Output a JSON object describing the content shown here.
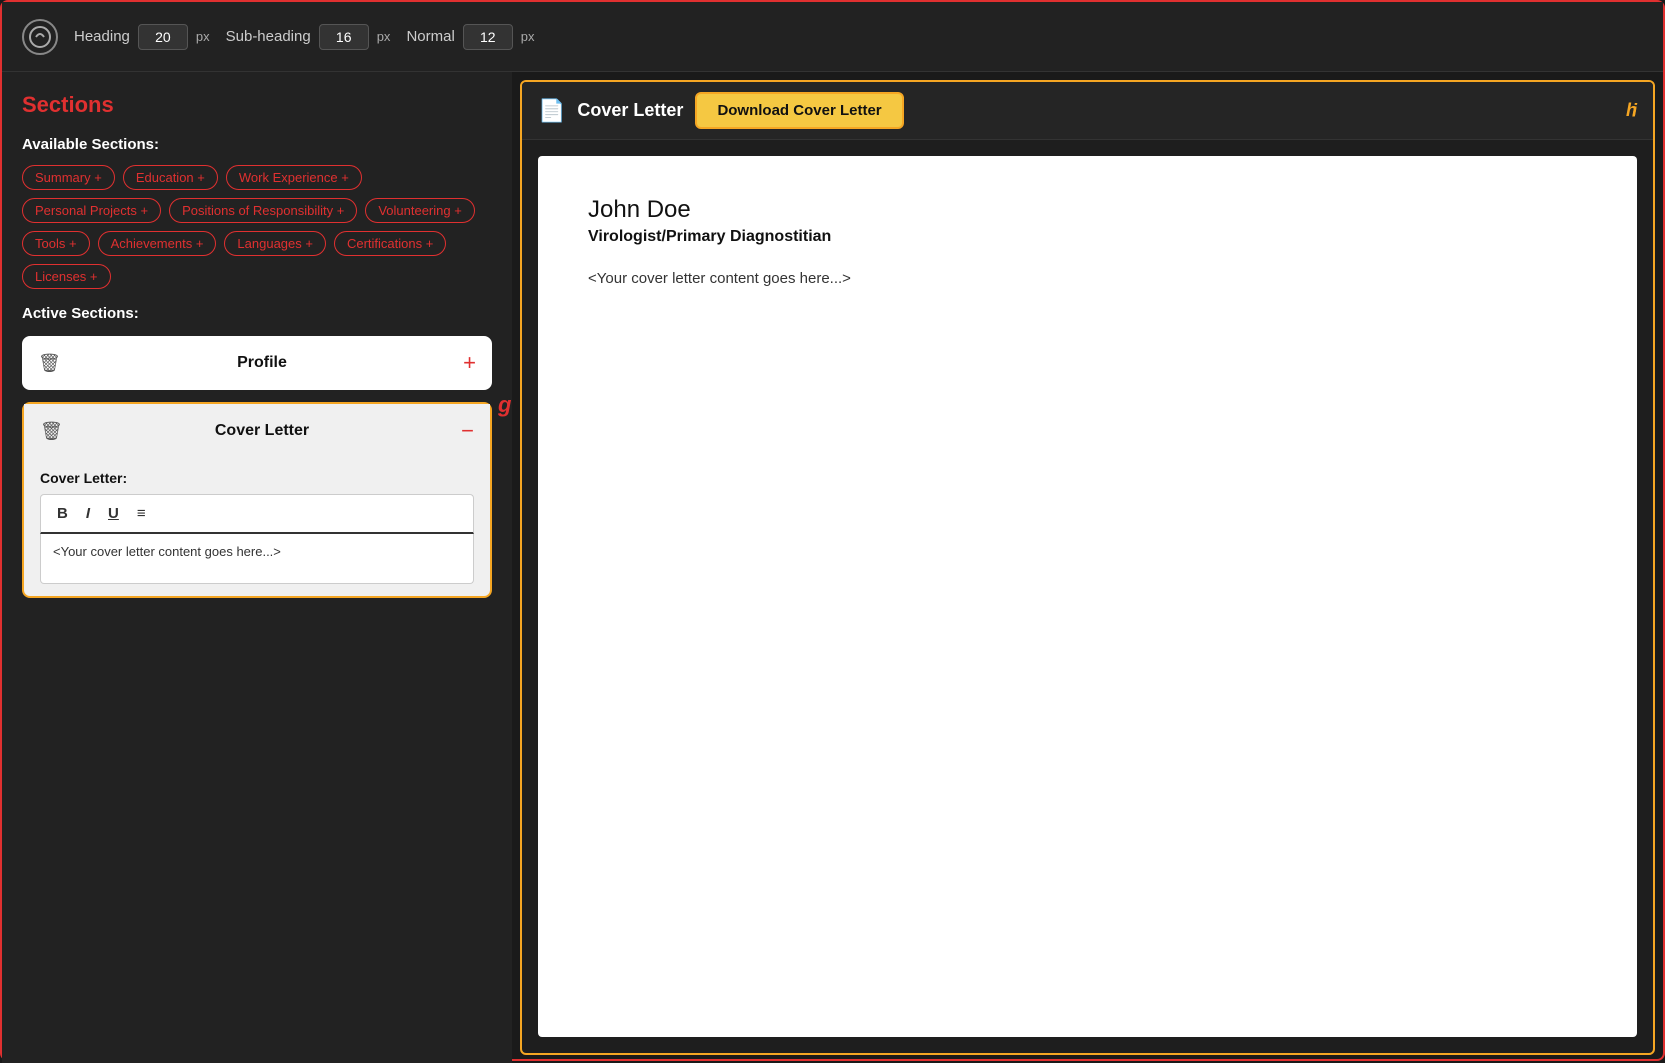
{
  "app": {
    "border_color": "#e03030",
    "corner_number": "3"
  },
  "toolbar": {
    "heading_label": "Heading",
    "heading_value": "20",
    "subheading_label": "Sub-heading",
    "subheading_value": "16",
    "normal_label": "Normal",
    "normal_value": "12",
    "px_label": "px"
  },
  "left_panel": {
    "title": "Sections",
    "available_label": "Available Sections:",
    "tags": [
      "Summary +",
      "Education +",
      "Work Experience +",
      "Personal Projects +",
      "Positions of Responsibility +",
      "Volunteering +",
      "Tools +",
      "Achievements +",
      "Languages +",
      "Certifications +",
      "Licenses +"
    ],
    "active_label": "Active Sections:",
    "active_sections": [
      {
        "id": "profile",
        "title": "Profile",
        "action_icon": "plus"
      },
      {
        "id": "cover-letter",
        "title": "Cover Letter",
        "action_icon": "minus",
        "is_active": true,
        "field_label": "Cover Letter:",
        "content": "<Your cover letter content goes here...>"
      }
    ]
  },
  "right_panel": {
    "doc_icon": "📄",
    "title": "Cover Letter",
    "download_button": "Download Cover Letter",
    "badge_h": "h",
    "badge_i": "i",
    "badge_g": "g",
    "document": {
      "name": "John Doe",
      "job_title": "Virologist/Primary Diagnostitian",
      "content_placeholder": "<Your cover letter content goes here...>"
    }
  },
  "rich_text": {
    "bold": "B",
    "italic": "I",
    "underline": "U",
    "list": "≡"
  }
}
